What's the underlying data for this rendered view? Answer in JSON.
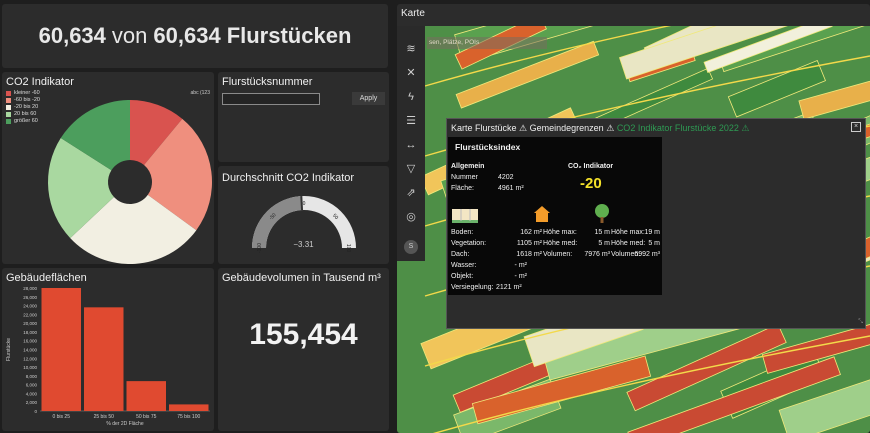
{
  "header": {
    "count": "60,634",
    "connector": "von",
    "total": "60,634",
    "unit": "Flurstücken"
  },
  "co2_panel": {
    "title": "CO2 Indikator",
    "legend": [
      {
        "label": "kleiner -60",
        "color": "#d9534f"
      },
      {
        "label": "-60 bis -20",
        "color": "#ef8f7e"
      },
      {
        "label": "-20 bis 20",
        "color": "#f2efe2"
      },
      {
        "label": "20 bis 60",
        "color": "#a9d8a0"
      },
      {
        "label": "größer 60",
        "color": "#4c9e5d"
      }
    ],
    "corner_label": "abc (123"
  },
  "chart_data": [
    {
      "type": "pie",
      "title": "CO2 Indikator",
      "categories": [
        "kleiner -60",
        "-60 bis -20",
        "-20 bis 20",
        "20 bis 60",
        "größer 60"
      ],
      "values": [
        11,
        24,
        28,
        21,
        16
      ]
    },
    {
      "type": "bar",
      "title": "Gebäudeflächen",
      "categories": [
        "0 bis 25",
        "25 bis 50",
        "50 bis 75",
        "75 bis 100"
      ],
      "values": [
        28000,
        23600,
        6800,
        1500
      ],
      "xlabel": "% der 2D Fläche",
      "ylabel": "Flurstücke",
      "ylim": [
        0,
        28000
      ],
      "yticks": [
        "0",
        "2,000",
        "4,000",
        "6,000",
        "8,000",
        "10,000",
        "12,000",
        "14,000",
        "16,000",
        "18,000",
        "20,000",
        "22,000",
        "24,000",
        "26,000",
        "28,000"
      ]
    },
    {
      "type": "gauge",
      "title": "Durchschnitt CO2 Indikator",
      "value": -3.31,
      "range": [
        -100,
        100
      ],
      "ticks": [
        "-100",
        "-50",
        "0",
        "50",
        "100"
      ]
    }
  ],
  "nummer_panel": {
    "title": "Flurstücksnummer",
    "input_value": "",
    "apply_label": "Apply"
  },
  "avg_panel": {
    "title": "Durchschnitt CO2 Indikator",
    "value_label": "−3.31"
  },
  "flaechen_panel": {
    "title": "Gebäudeflächen"
  },
  "volumen_panel": {
    "title": "Gebäudevolumen in Tausend m³",
    "value": "155,454"
  },
  "map": {
    "title": "Karte",
    "search_placeholder": "sen, Plätze, POIs",
    "popup": {
      "layer1": "Karte Flurstücke",
      "layer2": "Gemeindegrenzen",
      "layer3": "CO2 Indikator Flurstücke 2022",
      "close": "×"
    },
    "card": {
      "title": "Flurstücksindex",
      "allgemein": "Allgemein",
      "nummer_label": "Nummer",
      "nummer_value": "4202",
      "flaeche_label": "Fläche:",
      "flaeche_value": "4961 m²",
      "co2_label": "CO₂ Indikator",
      "co2_value": "-20",
      "col1": [
        {
          "label": "Boden:",
          "value": "162 m²"
        },
        {
          "label": "Vegetation:",
          "value": "1105 m²"
        },
        {
          "label": "Dach:",
          "value": "1618 m²"
        },
        {
          "label": "Wasser:",
          "value": "- m²"
        },
        {
          "label": "Objekt:",
          "value": "- m²"
        },
        {
          "label": "Versiegelung:",
          "value": "2121 m²"
        }
      ],
      "col2": [
        {
          "label": "Höhe max:",
          "value": "15 m"
        },
        {
          "label": "Höhe med:",
          "value": "5 m"
        },
        {
          "label": "Volumen:",
          "value": "7976 m³"
        }
      ],
      "col3": [
        {
          "label": "Höhe max:",
          "value": "19 m"
        },
        {
          "label": "Höhe med:",
          "value": "5 m"
        },
        {
          "label": "Volumen:",
          "value": "6992 m³"
        }
      ]
    }
  }
}
